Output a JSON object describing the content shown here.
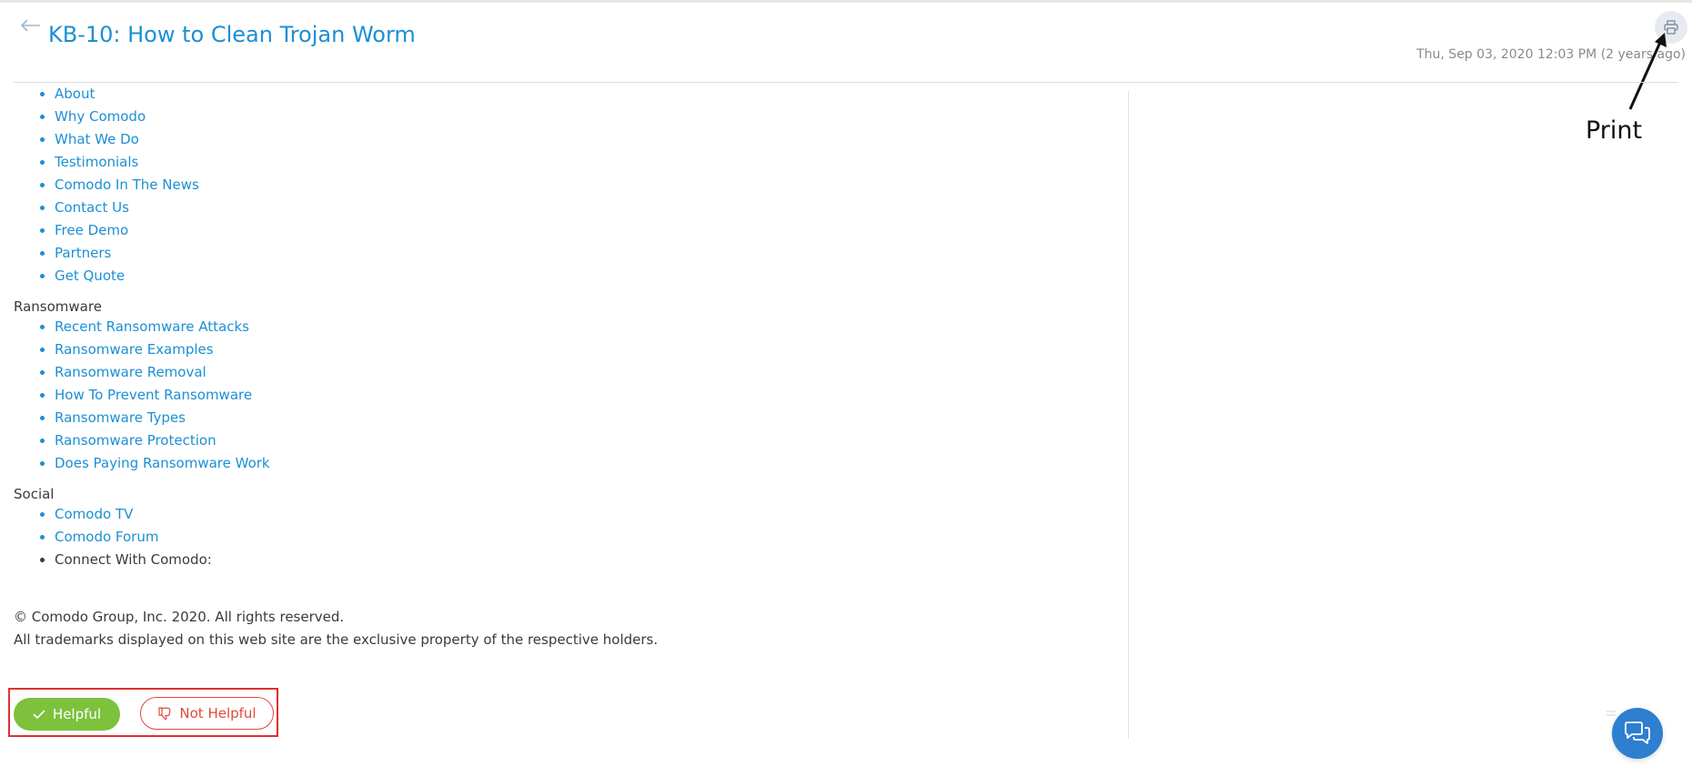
{
  "header": {
    "title": "KB-10: How to Clean Trojan Worm",
    "timestamp": "Thu, Sep 03, 2020 12:03 PM (2 years ago)"
  },
  "annotation": {
    "label": "Print"
  },
  "content": {
    "about_group": {
      "partial_item": "About",
      "items": [
        "Why Comodo",
        "What We Do",
        "Testimonials",
        "Comodo In The News",
        "Contact Us",
        "Free Demo",
        "Partners",
        "Get Quote"
      ]
    },
    "ransomware": {
      "heading": "Ransomware",
      "items": [
        "Recent Ransomware Attacks",
        "Ransomware Examples",
        "Ransomware Removal",
        "How To Prevent Ransomware",
        "Ransomware Types",
        "Ransomware Protection",
        "Does Paying Ransomware Work"
      ]
    },
    "social": {
      "heading": "Social",
      "items": [
        "Comodo TV",
        "Comodo Forum"
      ],
      "plain_item": "Connect With Comodo:"
    },
    "footer": {
      "copyright": "© Comodo Group, Inc. 2020. All rights reserved.",
      "trademarks": "All trademarks displayed on this web site are the exclusive property of the respective holders."
    }
  },
  "feedback": {
    "helpful_label": "Helpful",
    "not_helpful_label": "Not Helpful"
  },
  "colors": {
    "link": "#1c8fd3",
    "helpful": "#7dc13c",
    "not_helpful": "#e04a3a",
    "highlight_box": "#e03030",
    "chat": "#2e7fd0"
  },
  "icons": {
    "back": "arrow-left-icon",
    "print": "printer-icon",
    "helpful": "check-icon",
    "not_helpful": "thumbs-down-icon",
    "chat": "chat-bubbles-icon"
  }
}
